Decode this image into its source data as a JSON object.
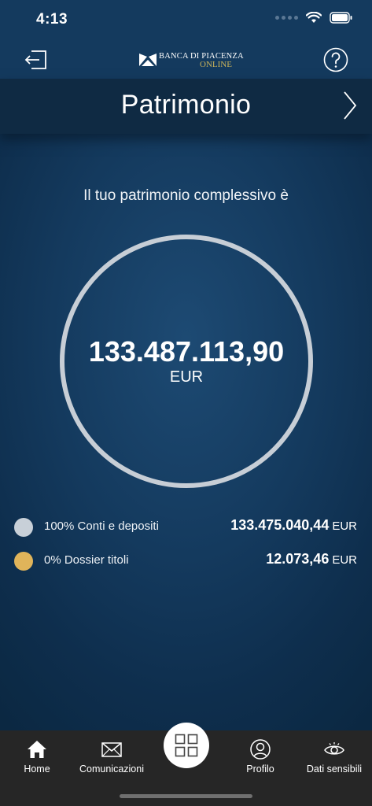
{
  "status_bar": {
    "time": "4:13"
  },
  "header": {
    "logo_line1": "BANCA DI PIACENZA",
    "logo_line2": "ONLINE"
  },
  "title_bar": {
    "title": "Patrimonio"
  },
  "summary": {
    "intro": "Il tuo patrimonio complessivo è",
    "total": "133.487.113,90",
    "currency": "EUR"
  },
  "breakdown": [
    {
      "label": "100% Conti e depositi",
      "value": "133.475.040,44",
      "currency": "EUR",
      "color": "#c8d0d8"
    },
    {
      "label": "0% Dossier titoli",
      "value": "12.073,46",
      "currency": "EUR",
      "color": "#e0b45a"
    }
  ],
  "tab_bar": {
    "home": "Home",
    "comunicazioni": "Comunicazioni",
    "profilo": "Profilo",
    "dati_sensibili": "Dati sensibili"
  },
  "icons": {
    "logout": "logout-icon",
    "help": "help-icon",
    "next": "chevron-right-icon",
    "home": "home-icon",
    "mail": "mail-icon",
    "grid": "grid-icon",
    "profile": "profile-icon",
    "eye": "eye-icon"
  },
  "colors": {
    "background": "#143a5e",
    "title_bar": "#0f2a43",
    "ring": "#c7ced6",
    "tab_bar": "#262626",
    "logo_accent": "#c9b25a"
  }
}
